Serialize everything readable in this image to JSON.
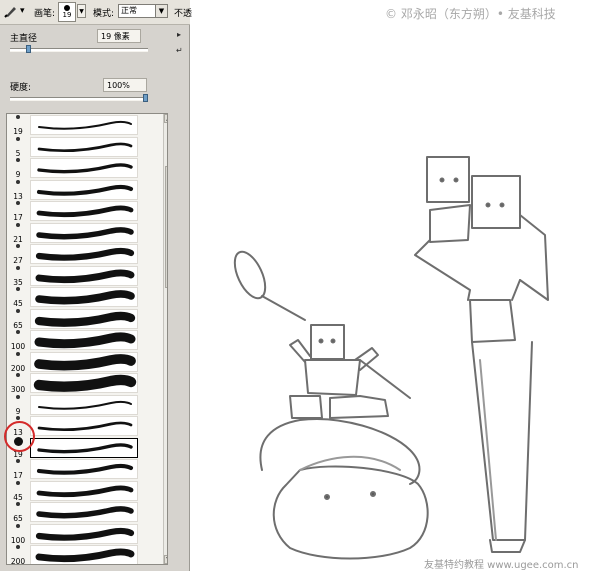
{
  "toolbar": {
    "tool_arrow": "▾",
    "brush_label": "画笔:",
    "brush_size": "19",
    "mode_label": "模式:",
    "mode_value": "正常",
    "opacity_label": "不透"
  },
  "settings": {
    "diameter_label": "主直径",
    "diameter_value": "19 像素",
    "diameter_fraction": 0.12,
    "hardness_label": "硬度:",
    "hardness_value": "100%",
    "hardness_fraction": 1.0
  },
  "brush_list": {
    "items": [
      {
        "size": "19"
      },
      {
        "size": "5"
      },
      {
        "size": "9"
      },
      {
        "size": "13"
      },
      {
        "size": "17"
      },
      {
        "size": "21"
      },
      {
        "size": "27"
      },
      {
        "size": "35"
      },
      {
        "size": "45"
      },
      {
        "size": "65"
      },
      {
        "size": "100"
      },
      {
        "size": "200"
      },
      {
        "size": "300"
      },
      {
        "size": "9"
      },
      {
        "size": "13"
      },
      {
        "size": "19",
        "selected": true
      },
      {
        "size": "17"
      },
      {
        "size": "45"
      },
      {
        "size": "65"
      },
      {
        "size": "100"
      },
      {
        "size": "200"
      }
    ]
  },
  "watermarks": {
    "top": "© 邓永昭（东方朔）• 友基科技",
    "bottom": "友基特约教程  www.ugee.com.cn"
  },
  "colors": {
    "panel_bg": "#d6d3ce",
    "highlight_circle": "#d42a2a",
    "sketch_line": "#6e6e6e"
  }
}
